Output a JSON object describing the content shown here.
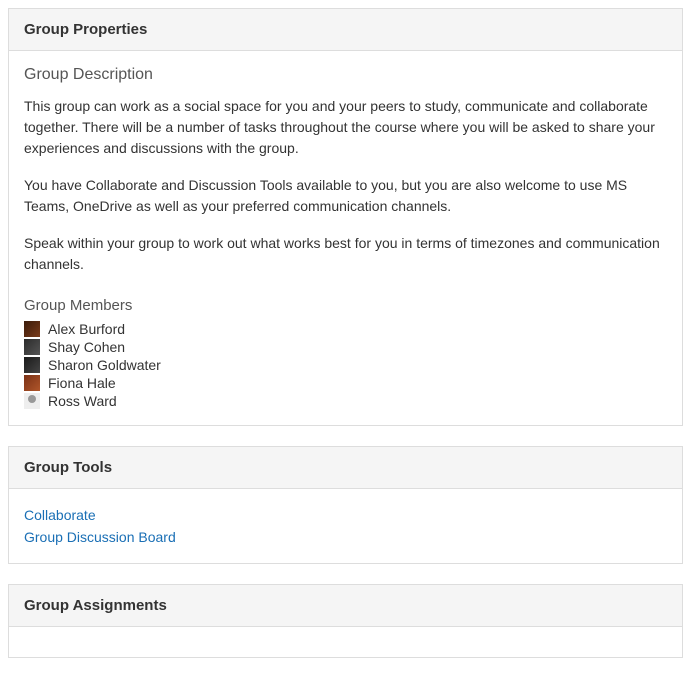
{
  "groupProperties": {
    "header": "Group Properties",
    "descriptionHeading": "Group Description",
    "descriptionParagraphs": [
      "This group can work as a social space for you and your peers to study, communicate and collaborate together. There will be a number of tasks throughout the course where you will be asked to share your experiences and discussions with the group.",
      "You have Collaborate and Discussion Tools available to you, but you are also welcome to use MS Teams, OneDrive as well as your preferred communication channels.",
      "Speak within your group to work out what works best for you in terms of timezones and communication channels."
    ],
    "membersHeading": "Group Members",
    "members": [
      {
        "name": "Alex Burford",
        "avatarClass": "av1"
      },
      {
        "name": "Shay Cohen",
        "avatarClass": "av2"
      },
      {
        "name": "Sharon Goldwater",
        "avatarClass": "av3"
      },
      {
        "name": "Fiona Hale",
        "avatarClass": "av4"
      },
      {
        "name": "Ross Ward",
        "avatarClass": "av5"
      }
    ]
  },
  "groupTools": {
    "header": "Group Tools",
    "tools": [
      {
        "label": "Collaborate"
      },
      {
        "label": "Group Discussion Board"
      }
    ]
  },
  "groupAssignments": {
    "header": "Group Assignments"
  }
}
